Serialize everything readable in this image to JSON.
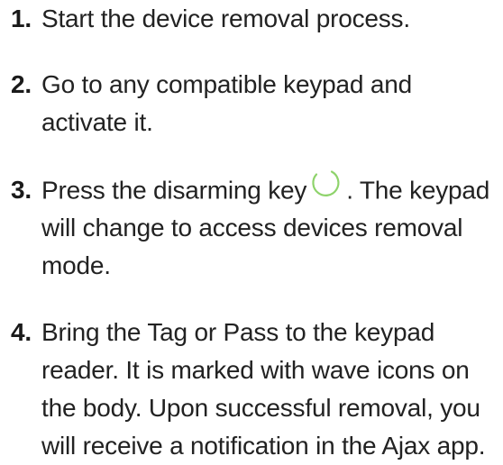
{
  "steps": [
    {
      "number": "1.",
      "lines": [
        "Start the device removal process."
      ]
    },
    {
      "number": "2.",
      "lines": [
        "Go to any compatible keypad and",
        "activate it."
      ]
    },
    {
      "number": "3.",
      "line1_before": "Press the disarming key",
      "line1_after": ". The keypad",
      "lines_rest": [
        "will change to access devices removal",
        "mode."
      ],
      "icon": "disarm-key-icon",
      "icon_color": "#8ed36b"
    },
    {
      "number": "4.",
      "lines": [
        "Bring the Tag or Pass to the keypad",
        "reader. It is marked with wave icons on",
        "the body. Upon successful removal, you",
        "will receive a notification in the Ajax app."
      ]
    }
  ]
}
